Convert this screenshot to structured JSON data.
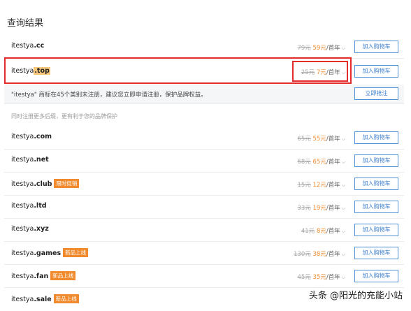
{
  "title": "查询结果",
  "cart_label": "加入购物车",
  "notice": {
    "text": "\"itestya\" 商标在45个类别未注册，建议您立即申请注册，保护品牌权益。",
    "button": "立即抢注"
  },
  "hint": "同时注册更多后缀，更有利于您的品牌保护",
  "watermark": "头条 @阳光的充能小站",
  "rows": [
    {
      "name": "itestya",
      "tld": ".cc",
      "old": "79元",
      "new": "59元",
      "unit": "/首年",
      "badge": ""
    },
    {
      "name": "itestya",
      "tld": ".top",
      "old": "25元",
      "new": "7元",
      "unit": "/首年",
      "badge": ""
    },
    {
      "name": "itestya",
      "tld": ".com",
      "old": "65元",
      "new": "55元",
      "unit": "/首年",
      "badge": ""
    },
    {
      "name": "itestya",
      "tld": ".net",
      "old": "68元",
      "new": "65元",
      "unit": "/首年",
      "badge": ""
    },
    {
      "name": "itestya",
      "tld": ".club",
      "old": "15元",
      "new": "12元",
      "unit": "/首年",
      "badge": "限时促销"
    },
    {
      "name": "itestya",
      "tld": ".ltd",
      "old": "33元",
      "new": "19元",
      "unit": "/首年",
      "badge": ""
    },
    {
      "name": "itestya",
      "tld": ".xyz",
      "old": "41元",
      "new": "8元",
      "unit": "/首年",
      "badge": ""
    },
    {
      "name": "itestya",
      "tld": ".games",
      "old": "130元",
      "new": "38元",
      "unit": "/首年",
      "badge": "新品上线"
    },
    {
      "name": "itestya",
      "tld": ".fan",
      "old": "45元",
      "new": "35元",
      "unit": "/首年",
      "badge": "新品上线"
    },
    {
      "name": "itestya",
      "tld": ".sale",
      "old": "",
      "new": "",
      "unit": "",
      "badge": "新品上线"
    }
  ]
}
